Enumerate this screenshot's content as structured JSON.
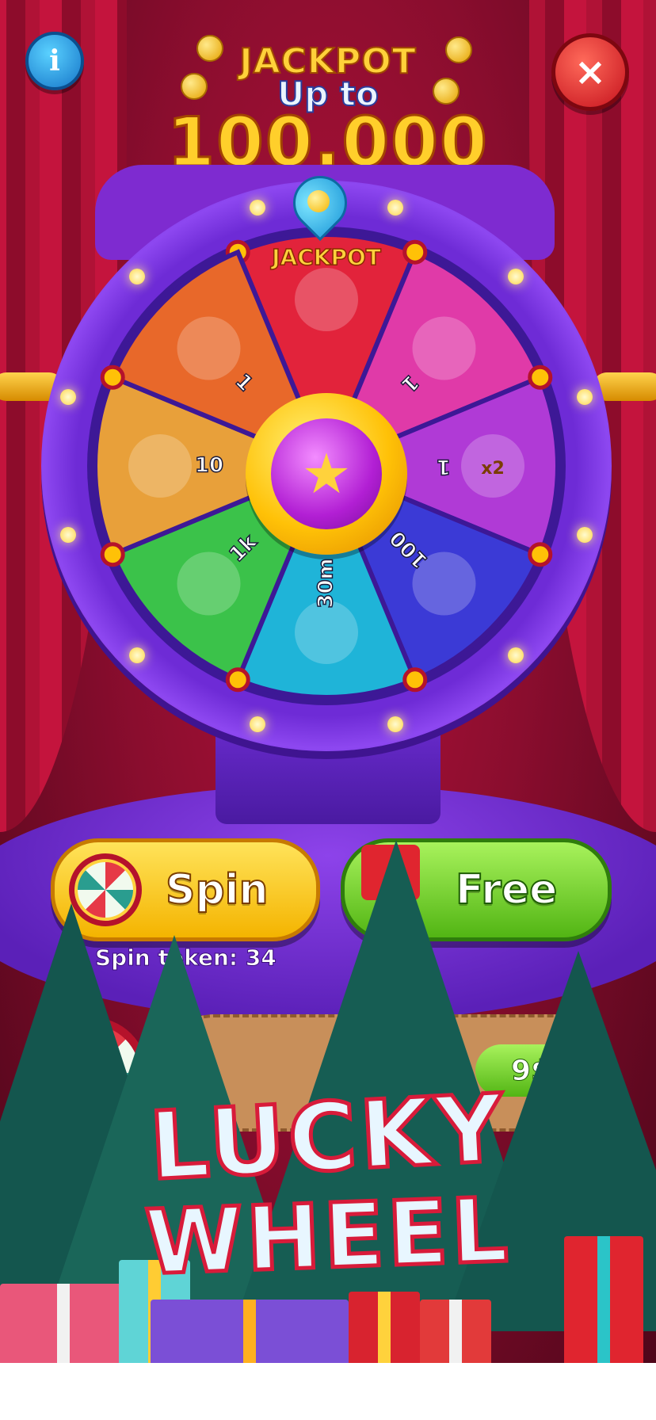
{
  "header": {
    "jackpot_label": "JACKPOT",
    "up_to_label": "Up to",
    "jackpot_amount": "100.000"
  },
  "controls": {
    "info_icon": "i",
    "close_icon": "×"
  },
  "wheel": {
    "segments": [
      {
        "label": "JACKPOT",
        "icon": "treasure-chest-icon",
        "color": "#e2233b"
      },
      {
        "label": "1",
        "icon": "paint-roller-icon",
        "color": "#e03aa8"
      },
      {
        "label": "1",
        "icon": "star-x2-icon",
        "color": "#b03ad6"
      },
      {
        "label": "100",
        "icon": "coins-icon",
        "color": "#3b3ad6"
      },
      {
        "label": "30m",
        "icon": "infinite-heart-icon",
        "color": "#1fb4d8"
      },
      {
        "label": "1k",
        "icon": "coins-icon",
        "color": "#3bc24a"
      },
      {
        "label": "10",
        "icon": "alarm-clock-icon",
        "color": "#e8a03a"
      },
      {
        "label": "1",
        "icon": "ticket-icon",
        "color": "#e8682a"
      }
    ],
    "x2_label": "x2",
    "hub_icon": "★"
  },
  "buttons": {
    "spin_label": "Spin",
    "free_label": "Free"
  },
  "spin_token_text": "Spin token: 34",
  "offer": {
    "price_label": "9$"
  },
  "logo": {
    "line1": "LUCKY",
    "line2": "WHEEL"
  }
}
